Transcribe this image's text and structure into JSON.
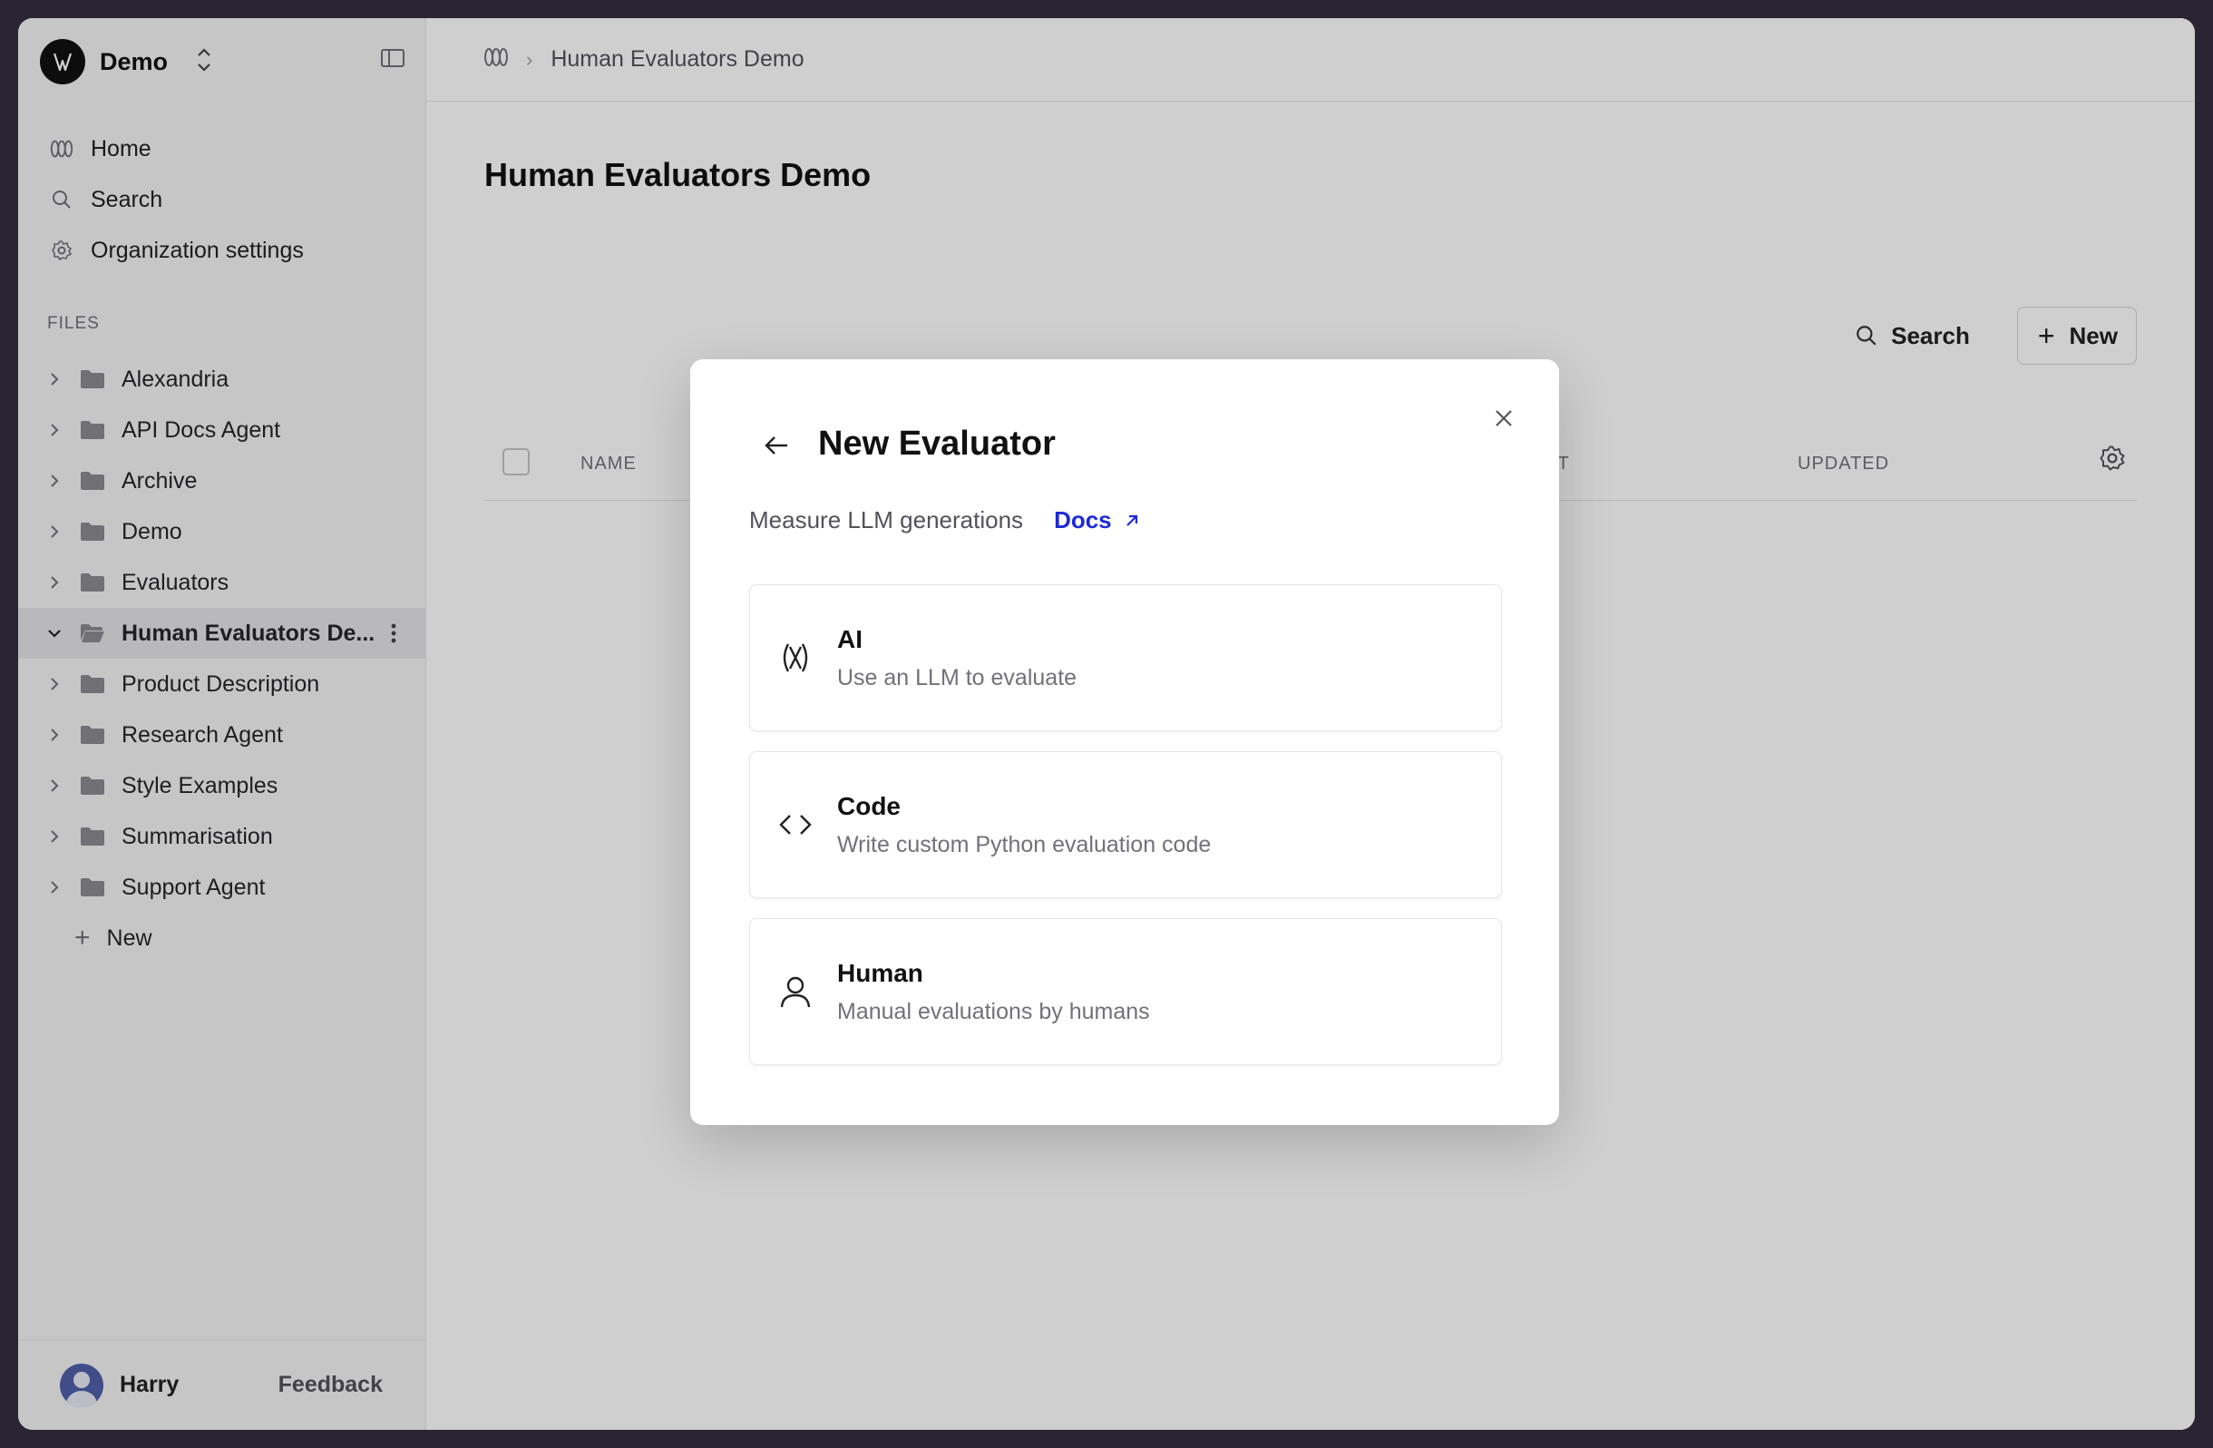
{
  "sidebar": {
    "org_name": "Demo",
    "nav": [
      {
        "label": "Home",
        "icon": "humanloop-logo-icon"
      },
      {
        "label": "Search",
        "icon": "search-icon"
      },
      {
        "label": "Organization settings",
        "icon": "gear-icon"
      }
    ],
    "files_label": "FILES",
    "folders": [
      {
        "label": "Alexandria",
        "expanded": false,
        "active": false
      },
      {
        "label": "API Docs Agent",
        "expanded": false,
        "active": false
      },
      {
        "label": "Archive",
        "expanded": false,
        "active": false
      },
      {
        "label": "Demo",
        "expanded": false,
        "active": false
      },
      {
        "label": "Evaluators",
        "expanded": false,
        "active": false
      },
      {
        "label": "Human Evaluators De...",
        "expanded": true,
        "active": true
      },
      {
        "label": "Product Description",
        "expanded": false,
        "active": false
      },
      {
        "label": "Research Agent",
        "expanded": false,
        "active": false
      },
      {
        "label": "Style Examples",
        "expanded": false,
        "active": false
      },
      {
        "label": "Summarisation",
        "expanded": false,
        "active": false
      },
      {
        "label": "Support Agent",
        "expanded": false,
        "active": false
      }
    ],
    "new_label": "New",
    "user_name": "Harry",
    "feedback_label": "Feedback"
  },
  "header": {
    "breadcrumb": "Human Evaluators Demo"
  },
  "main": {
    "title": "Human Evaluators Demo",
    "search_label": "Search",
    "new_label": "New",
    "columns": {
      "name": "NAME",
      "env": "NT",
      "updated": "UPDATED"
    }
  },
  "modal": {
    "title": "New Evaluator",
    "subtitle": "Measure LLM generations",
    "docs_label": "Docs",
    "options": [
      {
        "title": "AI",
        "description": "Use an LLM to evaluate",
        "icon": "ai-logo-icon"
      },
      {
        "title": "Code",
        "description": "Write custom Python evaluation code",
        "icon": "code-icon"
      },
      {
        "title": "Human",
        "description": "Manual evaluations by humans",
        "icon": "user-icon"
      }
    ]
  },
  "colors": {
    "accent_link": "#1d2bd6",
    "frame": "#2a2433"
  }
}
